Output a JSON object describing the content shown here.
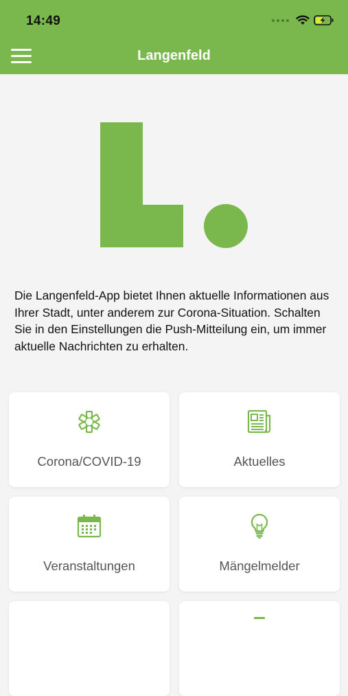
{
  "status": {
    "time": "14:49"
  },
  "header": {
    "title": "Langenfeld"
  },
  "logo": {
    "letter": "L",
    "color": "#7ab84e"
  },
  "intro": {
    "text": "Die Langenfeld-App bietet Ihnen aktuelle Informationen aus Ihrer Stadt, unter anderem zur Corona-Situation. Schalten Sie in den Einstellungen die Push-Mitteilung ein, um immer aktuelle Nachrichten zu erhalten."
  },
  "tiles": [
    {
      "label": "Corona/COVID-19",
      "icon": "asterisk-icon"
    },
    {
      "label": "Aktuelles",
      "icon": "newspaper-icon"
    },
    {
      "label": "Veranstaltungen",
      "icon": "calendar-icon"
    },
    {
      "label": "Mängelmelder",
      "icon": "lightbulb-icon"
    }
  ],
  "colors": {
    "accent": "#7ab84e",
    "background": "#f4f4f4",
    "tile": "#ffffff"
  }
}
